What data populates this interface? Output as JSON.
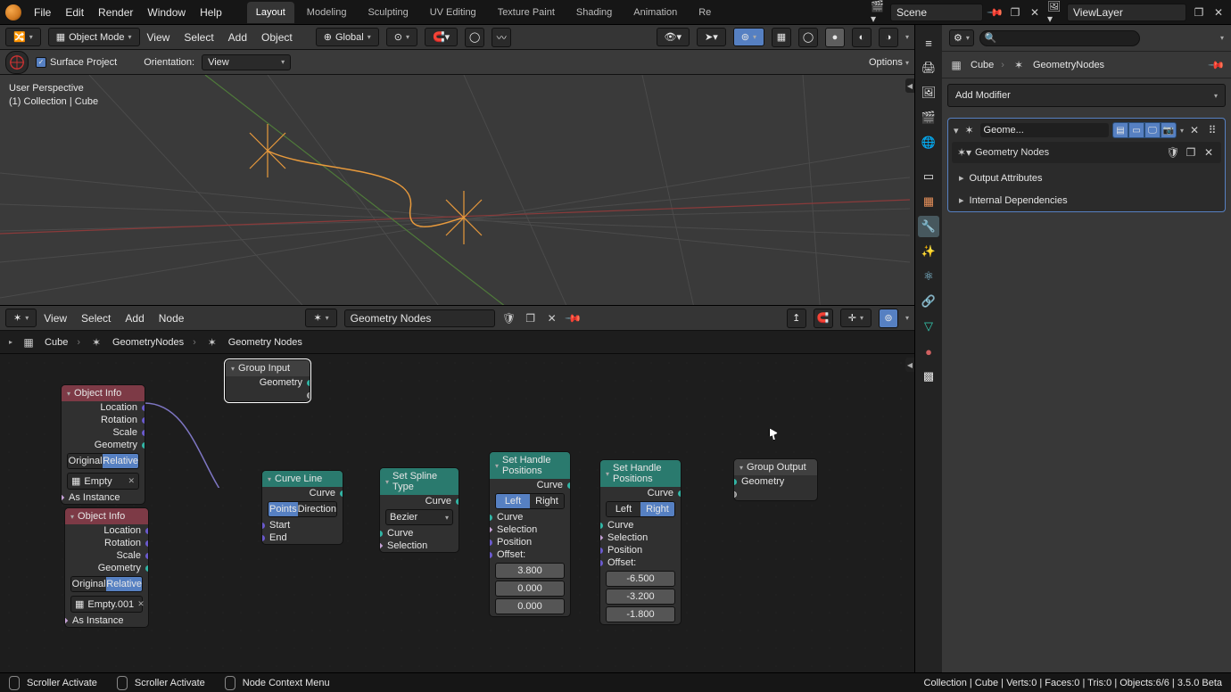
{
  "top": {
    "menus": [
      "File",
      "Edit",
      "Render",
      "Window",
      "Help"
    ],
    "tabs": [
      "Layout",
      "Modeling",
      "Sculpting",
      "UV Editing",
      "Texture Paint",
      "Shading",
      "Animation",
      "Re"
    ],
    "active_tab": 0,
    "scene": "Scene",
    "viewlayer": "ViewLayer"
  },
  "vp": {
    "mode": "Object Mode",
    "menus": [
      "View",
      "Select",
      "Add",
      "Object"
    ],
    "orient": "Global",
    "surface_project": "Surface Project",
    "orientation_lbl": "Orientation:",
    "orientation_val": "View",
    "options": "Options",
    "overlay1": "User Perspective",
    "overlay2": "(1) Collection | Cube"
  },
  "ne": {
    "menus": [
      "View",
      "Select",
      "Add",
      "Node"
    ],
    "tree": "Geometry Nodes",
    "crumbs": [
      "Cube",
      "GeometryNodes",
      "Geometry Nodes"
    ]
  },
  "props": {
    "crumb_obj": "Cube",
    "crumb_grp": "GeometryNodes",
    "add_modifier": "Add Modifier",
    "mod_name": "Geome...",
    "mod_tree": "Geometry Nodes",
    "sec1": "Output Attributes",
    "sec2": "Internal Dependencies"
  },
  "nodes": {
    "group_input": {
      "title": "Group Input",
      "out": "Geometry"
    },
    "obj1": {
      "title": "Object Info",
      "outs": [
        "Location",
        "Rotation",
        "Scale",
        "Geometry"
      ],
      "orig": "Original",
      "rel": "Relative",
      "obj": "Empty",
      "asinst": "As Instance"
    },
    "obj2": {
      "title": "Object Info",
      "outs": [
        "Location",
        "Rotation",
        "Scale",
        "Geometry"
      ],
      "orig": "Original",
      "rel": "Relative",
      "obj": "Empty.001",
      "asinst": "As Instance"
    },
    "curveline": {
      "title": "Curve Line",
      "out": "Curve",
      "mode": [
        "Points",
        "Direction"
      ],
      "ins": [
        "Start",
        "End"
      ]
    },
    "spline": {
      "title": "Set Spline Type",
      "out": "Curve",
      "type": "Bezier",
      "ins": [
        "Curve",
        "Selection"
      ]
    },
    "handle1": {
      "title": "Set Handle Positions",
      "out": "Curve",
      "lr": [
        "Left",
        "Right"
      ],
      "ins": [
        "Curve",
        "Selection",
        "Position",
        "Offset:"
      ],
      "vals": [
        "3.800",
        "0.000",
        "0.000"
      ]
    },
    "handle2": {
      "title": "Set Handle Positions",
      "out": "Curve",
      "lr": [
        "Left",
        "Right"
      ],
      "ins": [
        "Curve",
        "Selection",
        "Position",
        "Offset:"
      ],
      "vals": [
        "-6.500",
        "-3.200",
        "-1.800"
      ]
    },
    "group_output": {
      "title": "Group Output",
      "in": "Geometry"
    }
  },
  "status": {
    "hints": [
      "Scroller Activate",
      "Scroller Activate",
      "Node Context Menu"
    ],
    "right": "Collection | Cube | Verts:0 | Faces:0 | Tris:0 | Objects:6/6 | 3.5.0 Beta"
  }
}
